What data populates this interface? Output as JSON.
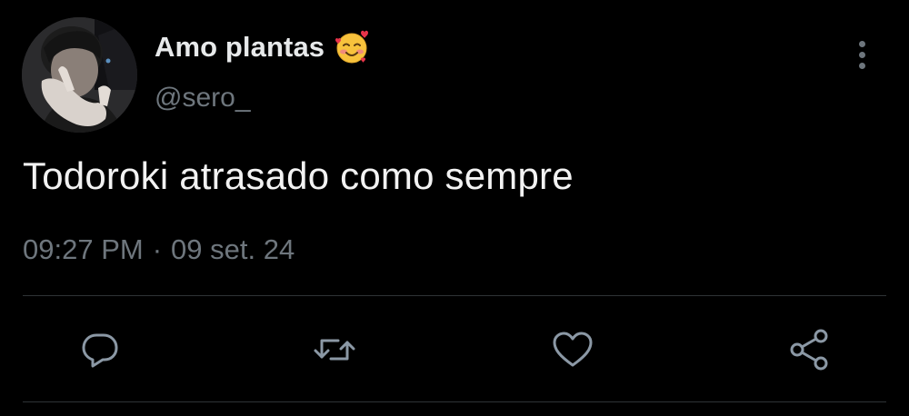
{
  "author": {
    "display_name": "Amo plantas",
    "name_emoji": "smiling-face-with-hearts-icon",
    "handle": "@sero_"
  },
  "tweet": {
    "text": "Todoroki atrasado como sempre",
    "time": "09:27 PM",
    "separator": "·",
    "date": "09 set. 24"
  },
  "actions": [
    {
      "name": "reply",
      "icon": "reply-icon"
    },
    {
      "name": "retweet",
      "icon": "retweet-icon"
    },
    {
      "name": "like",
      "icon": "heart-icon"
    },
    {
      "name": "share",
      "icon": "share-icon"
    }
  ],
  "menu": {
    "icon": "more-vertical-icon"
  },
  "colors": {
    "background": "#000000",
    "primary_text": "#e7e9ea",
    "secondary_text": "#6e767d",
    "divider": "#2f3336"
  }
}
